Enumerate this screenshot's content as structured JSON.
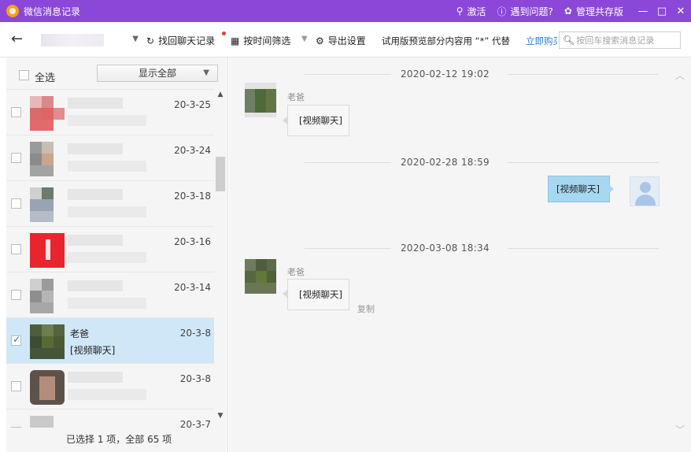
{
  "titlebar": {
    "app_title": "微信消息记录",
    "activate": "激活",
    "help": "遇到问题?",
    "manage_shared": "管理共存版",
    "min": "—",
    "max": "□",
    "close": "✕"
  },
  "toolbar": {
    "recover_label": "找回聊天记录",
    "filter_time_label": "按时间筛选",
    "export_label": "导出设置",
    "trial_notice": "试用版预览部分内容用 “*” 代替",
    "buy_link": "立即购买",
    "search_placeholder": "按回车搜索消息记录"
  },
  "left": {
    "select_all": "全选",
    "show_all": "显示全部",
    "items": [
      {
        "date": "20-3-25",
        "name": "",
        "preview": "",
        "checked": false
      },
      {
        "date": "20-3-24",
        "name": "",
        "preview": "",
        "checked": false
      },
      {
        "date": "20-3-18",
        "name": "",
        "preview": "",
        "checked": false
      },
      {
        "date": "20-3-16",
        "name": "",
        "preview": "",
        "checked": false
      },
      {
        "date": "20-3-14",
        "name": "",
        "preview": "",
        "checked": false
      },
      {
        "date": "20-3-8",
        "name": "老爸",
        "preview": "[视频聊天]",
        "checked": true
      },
      {
        "date": "20-3-8",
        "name": "",
        "preview": "",
        "checked": false
      },
      {
        "date": "20-3-7",
        "name": "",
        "preview": "",
        "checked": false
      }
    ],
    "footer": "已选择 1 项，全部 65 项"
  },
  "chat": {
    "messages": [
      {
        "timestamp": "2020-02-12 19:02",
        "sender": "老爸",
        "text": "[视频聊天]",
        "mine": false
      },
      {
        "timestamp": "2020-02-28 18:59",
        "sender": "",
        "text": "[视频聊天]",
        "mine": true
      },
      {
        "timestamp": "2020-03-08 18:34",
        "sender": "老爸",
        "text": "[视频聊天]",
        "mine": false,
        "copy": "复制"
      }
    ]
  },
  "colors": {
    "titlebar": "#8a47d8",
    "selected_row": "#cfe7f7",
    "my_bubble": "#a6d8f2",
    "link": "#2b7cd3"
  }
}
